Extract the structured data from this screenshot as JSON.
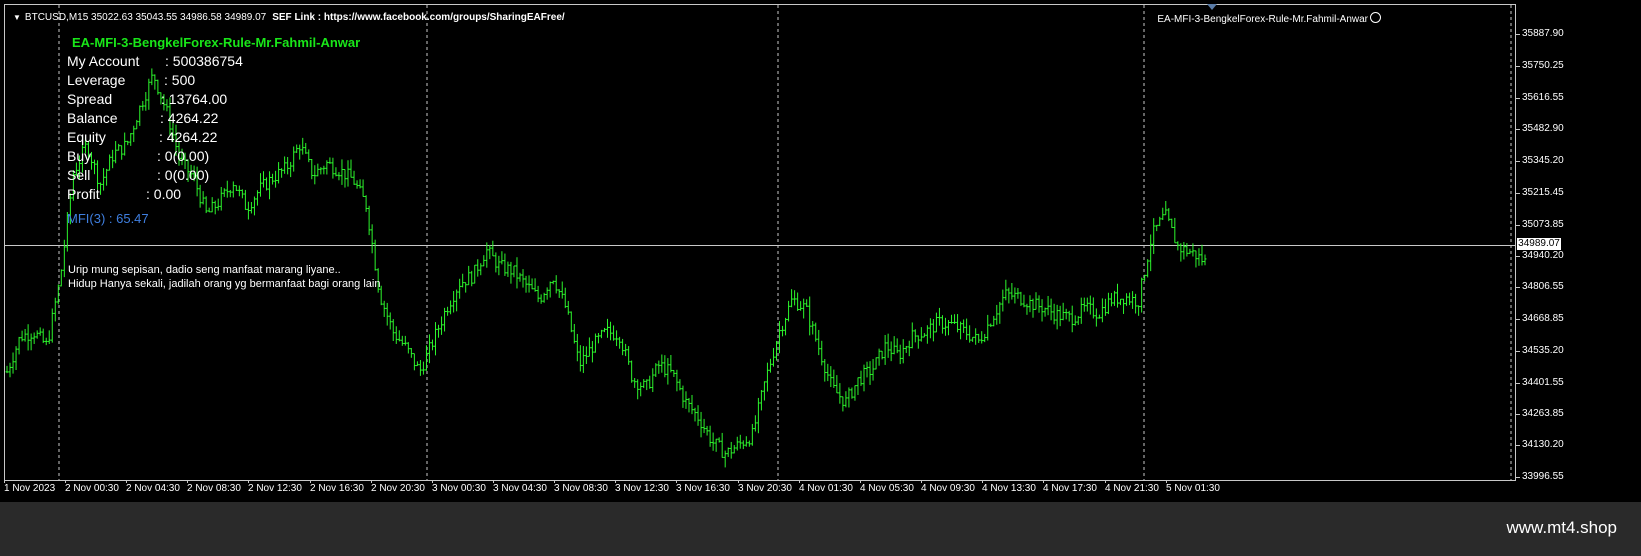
{
  "header": {
    "symbol_ohlc": "BTCUSD,M15  35022.63 35043.55 34986.58 34989.07",
    "sef_link": "SEF Link : https://www.facebook.com/groups/SharingEAFree/",
    "ea_name_right": "EA-MFI-3-BengkelForex-Rule-Mr.Fahmil-Anwar"
  },
  "ea_panel": {
    "title": "EA-MFI-3-BengkelForex-Rule-Mr.Fahmil-Anwar",
    "rows": [
      {
        "label": "My Account",
        "value": ": 500386754"
      },
      {
        "label": "Leverage",
        "value": ": 500"
      },
      {
        "label": "Spread",
        "value": ": 13764.00"
      },
      {
        "label": "Balance",
        "value": ": 4264.22"
      },
      {
        "label": "Equity",
        "value": ": 4264.22"
      },
      {
        "label": "Buy",
        "value": ": 0(0.00)"
      },
      {
        "label": "Sell",
        "value": ": 0(0.00)"
      },
      {
        "label": "Profit",
        "value": ": 0.00"
      }
    ],
    "mfi": "MFI(3) : 65.47",
    "quote_line_1": "Urip mung sepisan, dadio seng manfaat marang liyane..",
    "quote_line_2": "Hidup Hanya sekali, jadilah orang yg bermanfaat bagi orang lain"
  },
  "price_axis": {
    "ticks": [
      "35887.90",
      "35750.25",
      "35616.55",
      "35482.90",
      "35345.20",
      "35215.45",
      "35073.85",
      "34940.20",
      "34806.55",
      "34668.85",
      "34535.20",
      "34401.55",
      "34263.85",
      "34130.20",
      "33996.55"
    ],
    "current_price": "34989.07"
  },
  "time_axis": {
    "ticks": [
      "1 Nov 2023",
      "2 Nov 00:30",
      "2 Nov 04:30",
      "2 Nov 08:30",
      "2 Nov 12:30",
      "2 Nov 16:30",
      "2 Nov 20:30",
      "3 Nov 00:30",
      "3 Nov 04:30",
      "3 Nov 08:30",
      "3 Nov 12:30",
      "3 Nov 16:30",
      "3 Nov 20:30",
      "4 Nov 01:30",
      "4 Nov 05:30",
      "4 Nov 09:30",
      "4 Nov 13:30",
      "4 Nov 17:30",
      "4 Nov 21:30",
      "5 Nov 01:30"
    ]
  },
  "chart_data": {
    "type": "line",
    "symbol": "BTCUSD",
    "timeframe": "M15",
    "ylim": [
      33996.55,
      35887.9
    ],
    "current_price": 34989.07,
    "close_path": [
      34450,
      34600,
      34620,
      34560,
      34850,
      35300,
      35420,
      35250,
      35380,
      35420,
      35580,
      35720,
      35560,
      35350,
      35280,
      35120,
      35180,
      35260,
      35150,
      35230,
      35280,
      35320,
      35420,
      35290,
      35340,
      35310,
      35270,
      35160,
      34780,
      34620,
      34550,
      34450,
      34580,
      34720,
      34830,
      34860,
      34970,
      34900,
      34880,
      34820,
      34760,
      34860,
      34720,
      34480,
      34560,
      34620,
      34610,
      34420,
      34380,
      34480,
      34440,
      34320,
      34250,
      34150,
      34100,
      34140,
      34180,
      34420,
      34620,
      34760,
      34720,
      34550,
      34380,
      34320,
      34420,
      34460,
      34560,
      34520,
      34600,
      34620,
      34660,
      34650,
      34620,
      34580,
      34680,
      34780,
      34770,
      34740,
      34720,
      34690,
      34680,
      34720,
      34700,
      34760,
      34770,
      34750,
      35030,
      35120,
      34980,
      34960,
      34920
    ]
  },
  "footer": {
    "brand": "www.mt4.shop"
  },
  "colors": {
    "candle": "#2cf52c",
    "background": "#000000",
    "grid": "#c8c8c8",
    "title_green": "#19e619",
    "mfi_blue": "#3f7fe0",
    "footer_bg": "#2a2a2a"
  }
}
